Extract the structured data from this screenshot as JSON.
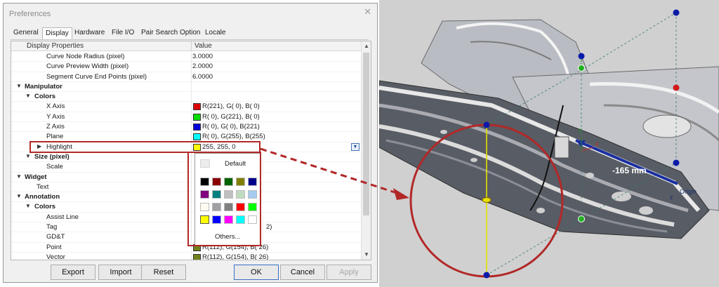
{
  "dialog": {
    "title": "Preferences",
    "tabs": [
      "General",
      "Display",
      "Hardware",
      "File I/O",
      "Pair Search Option",
      "Locale"
    ],
    "active_tab": "Display",
    "columns": {
      "property": "Display Properties",
      "value": "Value"
    },
    "rows": [
      {
        "label": "Curve Node Radius (pixel)",
        "value": "3.0000"
      },
      {
        "label": "Curve Preview Width (pixel)",
        "value": "2.0000"
      },
      {
        "label": "Segment Curve End Points (pixel)",
        "value": "6.0000"
      },
      {
        "label": "Manipulator",
        "value": ""
      },
      {
        "label": "Colors",
        "value": ""
      },
      {
        "label": "X Axis",
        "value": "R(221), G( 0), B( 0)",
        "color": "#dd0000"
      },
      {
        "label": "Y Axis",
        "value": "R( 0), G(221), B( 0)",
        "color": "#00dd00"
      },
      {
        "label": "Z Axis",
        "value": "R( 0), G( 0), B(221)",
        "color": "#0000dd"
      },
      {
        "label": "Plane",
        "value": "R( 0), G(255), B(255)",
        "color": "#00ffff"
      },
      {
        "label": "Highlight",
        "value": "255, 255, 0",
        "color": "#ffff00"
      },
      {
        "label": "Size (pixel)",
        "value": ""
      },
      {
        "label": "Scale",
        "value": ""
      },
      {
        "label": "Widget",
        "value": ""
      },
      {
        "label": "Text",
        "value": ""
      },
      {
        "label": "Annotation",
        "value": ""
      },
      {
        "label": "Colors",
        "value": ""
      },
      {
        "label": "Assist Line",
        "value": ""
      },
      {
        "label": "Tag",
        "value": "2)"
      },
      {
        "label": "GD&T",
        "value": ""
      },
      {
        "label": "Point",
        "value": "R(112), G(154), B( 26)",
        "color": "#70821a"
      },
      {
        "label": "Vector",
        "value": "R(112), G(154), B( 26)",
        "color": "#70821a"
      }
    ],
    "color_popup": {
      "default_label": "Default",
      "others_label": "Others...",
      "palette": [
        "#000000",
        "#8b0000",
        "#006400",
        "#808000",
        "#00008b",
        "#800080",
        "#008080",
        "#c0c0c0",
        "#c0dcc0",
        "#a6caf0",
        "#fffbf0",
        "#a0a0a4",
        "#808080",
        "#ff0000",
        "#00ff00",
        "#ffff00",
        "#0000ff",
        "#ff00ff",
        "#00ffff",
        "#ffffff"
      ]
    },
    "buttons": {
      "export": "Export",
      "import": "Import",
      "reset": "Reset",
      "ok": "OK",
      "cancel": "Cancel",
      "apply": "Apply"
    }
  },
  "viewport": {
    "dimension_label": "-165 mm",
    "origin_label": "Origin",
    "axis_labels": [
      "y",
      "x",
      "z"
    ]
  },
  "colors": {
    "accent_red": "#b22828",
    "highlight_yellow": "#ffff00",
    "node_blue": "#0a1aa8"
  }
}
